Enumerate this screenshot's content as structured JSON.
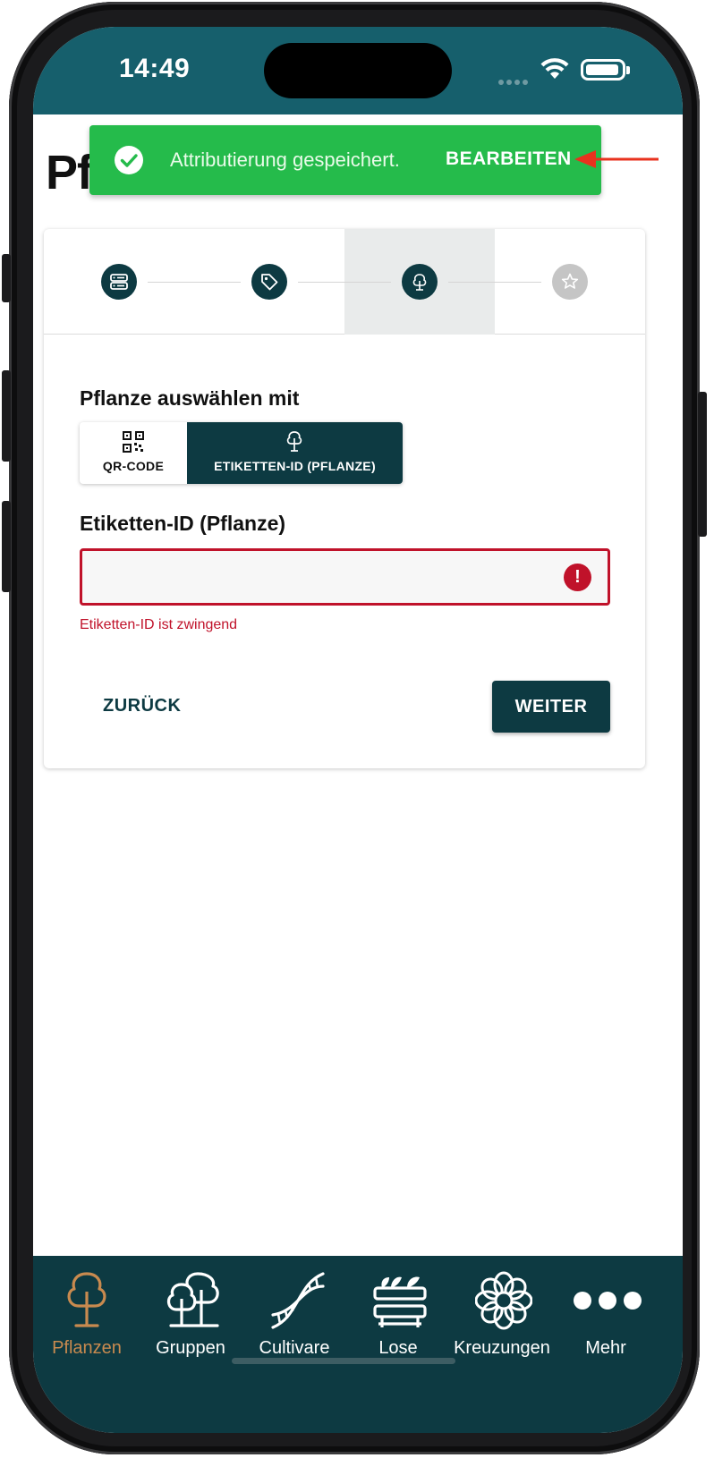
{
  "status_bar": {
    "time": "14:49"
  },
  "page": {
    "title": "Pf"
  },
  "toast": {
    "message": "Attributierung gespeichert.",
    "action": "BEARBEITEN",
    "color": "#25bb4b"
  },
  "stepper": {
    "steps": [
      {
        "icon": "form-icon",
        "state": "done"
      },
      {
        "icon": "tag-icon",
        "state": "done"
      },
      {
        "icon": "tree-icon",
        "state": "active"
      },
      {
        "icon": "star-icon",
        "state": "pending"
      }
    ]
  },
  "form": {
    "select_label": "Pflanze auswählen mit",
    "options": [
      {
        "label": "QR-CODE",
        "icon": "qr-code-icon",
        "selected": false
      },
      {
        "label": "ETIKETTEN-ID (PFLANZE)",
        "icon": "tree-icon",
        "selected": true
      }
    ],
    "field_label": "Etiketten-ID (Pflanze)",
    "field_value": "",
    "error_text": "Etiketten-ID ist zwingend",
    "back_label": "ZURÜCK",
    "next_label": "WEITER"
  },
  "bottom_nav": {
    "items": [
      {
        "label": "Pflanzen",
        "icon": "tree-icon",
        "active": true
      },
      {
        "label": "Gruppen",
        "icon": "trees-icon",
        "active": false
      },
      {
        "label": "Cultivare",
        "icon": "dna-icon",
        "active": false
      },
      {
        "label": "Lose",
        "icon": "seedling-tray-icon",
        "active": false
      },
      {
        "label": "Kreuzungen",
        "icon": "flower-icon",
        "active": false
      },
      {
        "label": "Mehr",
        "icon": "more-dots-icon",
        "active": false
      }
    ]
  },
  "colors": {
    "primary": "#0d3a42",
    "status_bar": "#165f6c",
    "error": "#c0122a",
    "active_nav": "#c88a4f",
    "annotation_arrow": "#e8321e"
  }
}
